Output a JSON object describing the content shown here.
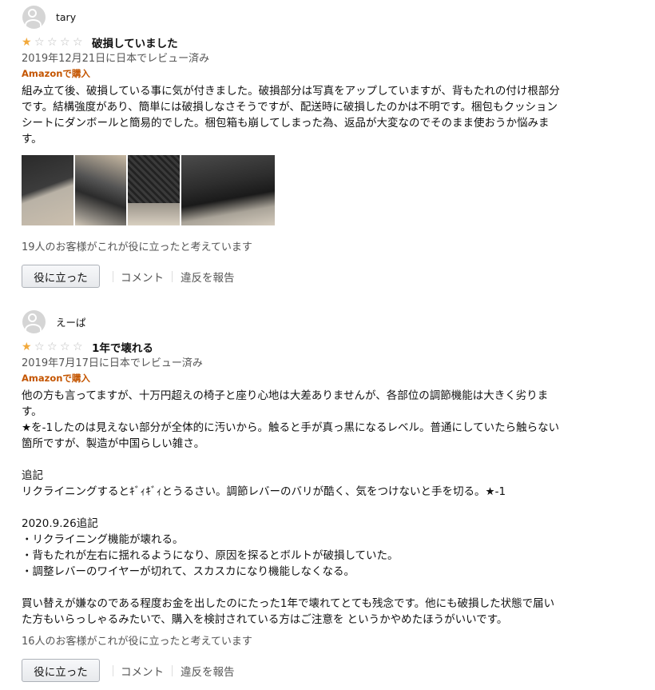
{
  "reviews": [
    {
      "user": "tary",
      "rating": 1,
      "stars": [
        "★",
        "☆",
        "☆",
        "☆",
        "☆"
      ],
      "title": "破損していました",
      "date": "2019年12月21日に日本でレビュー済み",
      "verified": "Amazonで購入",
      "body": "組み立て後、破損している事に気が付きました。破損部分は写真をアップしていますが、背もたれの付け根部分です。結構強度があり、簡単には破損しなさそうですが、配送時に破損したのかは不明です。梱包もクッションシートにダンボールと簡易的でした。梱包箱も崩してしまった為、返品が大変なのでそのまま使おうか悩みます。",
      "helpful": "19人のお客様がこれが役に立ったと考えています",
      "helpful_button": "役に立った",
      "comment": "コメント",
      "report": "違反を報告"
    },
    {
      "user": "えーぱ",
      "rating": 1,
      "stars": [
        "★",
        "☆",
        "☆",
        "☆",
        "☆"
      ],
      "title": "1年で壊れる",
      "date": "2019年7月17日に日本でレビュー済み",
      "verified": "Amazonで購入",
      "body": "他の方も言ってますが、十万円超えの椅子と座り心地は大差ありませんが、各部位の調節機能は大きく劣ります。\n★を-1したのは見えない部分が全体的に汚いから。触ると手が真っ黒になるレベル。普通にしていたら触らない箇所ですが、製造が中国らしい雑さ。\n\n追記\nリクライニングするとｷﾞｨｷﾞｨとうるさい。調節レバーのバリが酷く、気をつけないと手を切る。★-1\n\n2020.9.26追記\n・リクライニング機能が壊れる。\n・背もたれが左右に揺れるようになり、原因を探るとボルトが破損していた。\n・調整レバーのワイヤーが切れて、スカスカになり機能しなくなる。\n\n買い替えが嫌なのである程度お金を出したのにたった1年で壊れてとても残念です。他にも破損した状態で届いた方もいらっしゃるみたいで、購入を検討されている方はご注意を というかやめたほうがいいです。",
      "helpful": "16人のお客様がこれが役に立ったと考えています",
      "helpful_button": "役に立った",
      "comment": "コメント",
      "report": "違反を報告"
    }
  ],
  "colors": {
    "star": "#f2a93b",
    "verified": "#c45500"
  }
}
